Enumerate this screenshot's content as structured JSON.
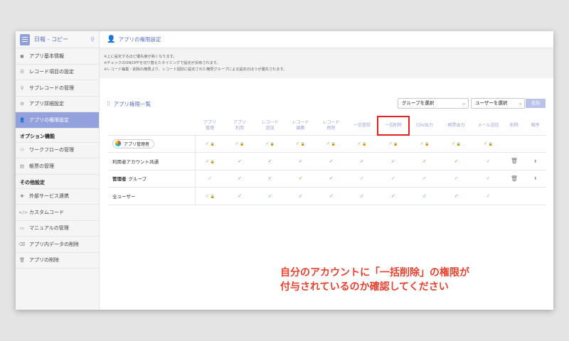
{
  "app": {
    "name": "日報 - コピー"
  },
  "sidebar": {
    "items": [
      {
        "label": "アプリ基本情報",
        "icon": "info-icon",
        "glyph": "◼"
      },
      {
        "label": "レコード項目の設定",
        "icon": "list-icon",
        "glyph": "☰"
      },
      {
        "label": "サブレコードの管理",
        "icon": "link-icon",
        "glyph": "⚲"
      },
      {
        "label": "アプリ詳細設定",
        "icon": "gear-icon",
        "glyph": "⚙"
      },
      {
        "label": "アプリの権限設定",
        "icon": "user-lock-icon",
        "glyph": "👤",
        "active": true
      }
    ],
    "option_title": "オプション機能",
    "option_items": [
      {
        "label": "ワークフローの管理",
        "icon": "workflow-icon",
        "glyph": "⚇"
      },
      {
        "label": "帳票の管理",
        "icon": "document-icon",
        "glyph": "▤"
      }
    ],
    "other_title": "その他設定",
    "other_items": [
      {
        "label": "外部サービス連携",
        "icon": "puzzle-icon",
        "glyph": "✚"
      },
      {
        "label": "カスタムコード",
        "icon": "code-icon",
        "glyph": "</>"
      },
      {
        "label": "マニュアルの管理",
        "icon": "book-icon",
        "glyph": "▭"
      },
      {
        "label": "アプリ内データの削除",
        "icon": "erase-icon",
        "glyph": "⌫"
      },
      {
        "label": "アプリの削除",
        "icon": "trash-icon",
        "glyph": "🗑"
      }
    ]
  },
  "main": {
    "title": "アプリの権限設定",
    "notes": [
      "※上に設定するほど優先度が高くなります。",
      "※チェックのON/OFFを切り替えたタイミングで設定が反映されます。",
      "※レコード編集・削除の権限より、レコード個別に設定された権限グループによる設定のほうが優先されます。"
    ],
    "list_title": "アプリ権限一覧",
    "group_select": "グループを選択",
    "user_select": "ユーザーを選択",
    "add_label": "追加"
  },
  "table": {
    "headers": [
      [
        "アプリ",
        "管理"
      ],
      [
        "アプリ",
        "利用"
      ],
      [
        "レコード",
        "追加"
      ],
      [
        "レコード",
        "編集"
      ],
      [
        "レコード",
        "削除"
      ],
      [
        "一括登録"
      ],
      [
        "一括削除"
      ],
      [
        "CSV出力"
      ],
      [
        "帳票出力"
      ],
      [
        "メール送信"
      ],
      [
        "削除"
      ],
      [
        "順序"
      ]
    ],
    "rows": [
      {
        "name": "アプリ管理者",
        "type": "tag",
        "checks": [
          "lock",
          "lock",
          "lock",
          "lock",
          "lock",
          "lock",
          "lock",
          "lock",
          "lock",
          "lock"
        ],
        "actions": false
      },
      {
        "name": "利用者アカウント共通",
        "type": "plain",
        "checks": [
          "lock",
          "on",
          "on",
          "on",
          "on",
          "on",
          "on",
          "on",
          "on",
          "muted"
        ],
        "actions": true
      },
      {
        "name": "管理者",
        "suffix": "グループ",
        "type": "group",
        "checks": [
          "muted",
          "on",
          "on",
          "on",
          "on",
          "muted",
          "muted",
          "muted",
          "muted",
          "muted"
        ],
        "actions": true
      },
      {
        "name": "全ユーザー",
        "type": "plain",
        "checks": [
          "lock",
          "on",
          "on",
          "on",
          "on",
          "on",
          "on",
          "on",
          "on",
          "muted"
        ],
        "actions": false
      }
    ]
  },
  "annotation": {
    "line1": "自分のアカウントに「一括削除」の権限が",
    "line2": "付与されているのか確認してください"
  },
  "colors": {
    "accent": "#93a2dc",
    "check": "#67b542",
    "highlight": "#e62020",
    "annotation": "#e8412e"
  }
}
